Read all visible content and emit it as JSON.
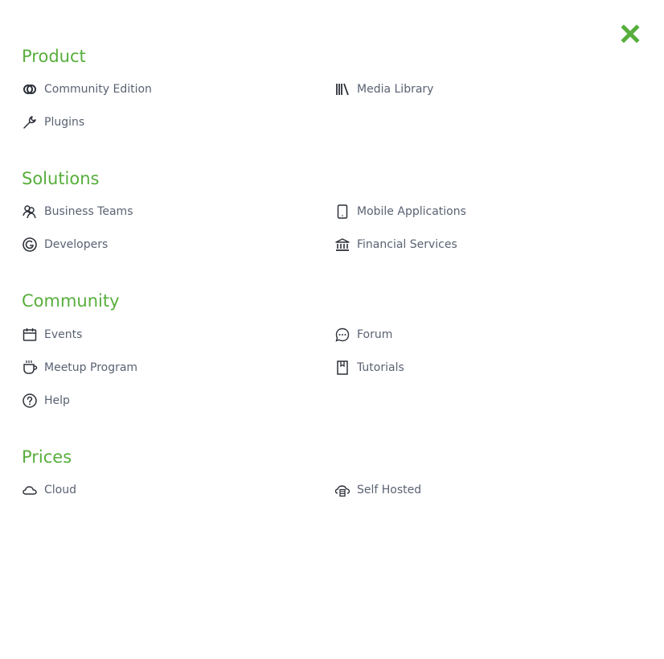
{
  "colors": {
    "accent": "#57ae3c",
    "text": "#5a6272",
    "icon": "#2c3038"
  },
  "close": {
    "icon": "close-icon"
  },
  "sections": [
    {
      "title": "Product",
      "items": [
        {
          "label": "Community Edition",
          "icon": "overlap-circles-icon"
        },
        {
          "label": "Media Library",
          "icon": "library-icon"
        },
        {
          "label": "Plugins",
          "icon": "wrench-icon"
        }
      ]
    },
    {
      "title": "Solutions",
      "items": [
        {
          "label": "Business Teams",
          "icon": "users-icon"
        },
        {
          "label": "Mobile Applications",
          "icon": "mobile-icon"
        },
        {
          "label": "Developers",
          "icon": "code-circle-icon"
        },
        {
          "label": "Financial Services",
          "icon": "bank-icon"
        }
      ]
    },
    {
      "title": "Community",
      "items": [
        {
          "label": "Events",
          "icon": "calendar-icon"
        },
        {
          "label": "Forum",
          "icon": "chat-icon"
        },
        {
          "label": "Meetup Program",
          "icon": "coffee-icon"
        },
        {
          "label": "Tutorials",
          "icon": "bookmark-icon"
        },
        {
          "label": "Help",
          "icon": "help-icon"
        }
      ]
    },
    {
      "title": "Prices",
      "items": [
        {
          "label": "Cloud",
          "icon": "cloud-icon"
        },
        {
          "label": "Self Hosted",
          "icon": "server-cloud-icon"
        }
      ]
    }
  ]
}
